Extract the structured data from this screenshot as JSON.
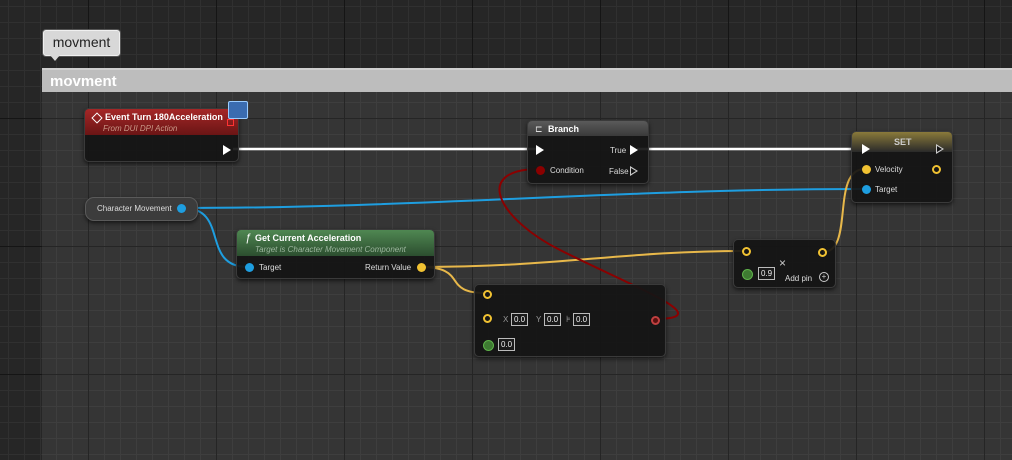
{
  "comment": {
    "bubble_text": "movment",
    "title": "movment"
  },
  "event_node": {
    "title": "Event Turn 180Acceleration",
    "subtitle": "From DUI DPI Action"
  },
  "variable_node": {
    "label": "Character Movement"
  },
  "get_accel_node": {
    "title": "Get Current Acceleration",
    "subtitle": "Target is Character Movement Component",
    "target_label": "Target",
    "return_label": "Return Value"
  },
  "branch_node": {
    "title": "Branch",
    "true_label": "True",
    "false_label": "False",
    "condition_label": "Condition"
  },
  "set_node": {
    "title": "SET",
    "velocity_label": "Velocity",
    "target_label": "Target"
  },
  "multiply_node": {
    "value": "0.9",
    "add_pin_label": "Add pin"
  },
  "vector_node": {
    "x_label": "X",
    "x_value": "0.0",
    "y_label": "Y",
    "y_value": "0.0",
    "z_value": "0.0",
    "float_value": "0.0"
  },
  "colors": {
    "exec": "#ffffff",
    "object": "#1e9ee0",
    "vector": "#f1c232",
    "bool": "#8b0000",
    "float": "#5fb34a"
  }
}
